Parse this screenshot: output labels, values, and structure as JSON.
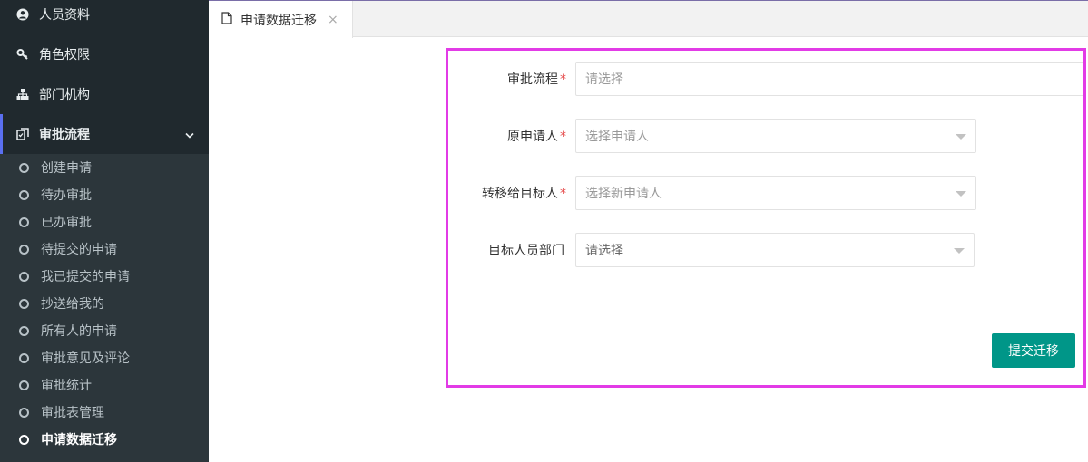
{
  "sidebar": {
    "items": [
      {
        "label": "人员资料",
        "icon": "user-circle-icon"
      },
      {
        "label": "角色权限",
        "icon": "key-icon"
      },
      {
        "label": "部门机构",
        "icon": "org-chart-icon"
      },
      {
        "label": "审批流程",
        "icon": "approval-icon",
        "expanded": true
      }
    ],
    "sub_items": [
      {
        "label": "创建申请"
      },
      {
        "label": "待办审批"
      },
      {
        "label": "已办审批"
      },
      {
        "label": "待提交的申请"
      },
      {
        "label": "我已提交的申请"
      },
      {
        "label": "抄送给我的"
      },
      {
        "label": "所有人的申请"
      },
      {
        "label": "审批意见及评论"
      },
      {
        "label": "审批统计"
      },
      {
        "label": "审批表管理"
      },
      {
        "label": "申请数据迁移",
        "current": true
      }
    ]
  },
  "tabs": [
    {
      "label": "申请数据迁移",
      "close": "×"
    }
  ],
  "form": {
    "fields": [
      {
        "label": "审批流程",
        "required_mark": "*",
        "placeholder": "请选择"
      },
      {
        "label": "原申请人",
        "required_mark": "*",
        "placeholder": "选择申请人"
      },
      {
        "label": "转移给目标人",
        "required_mark": "*",
        "placeholder": "选择新申请人"
      },
      {
        "label": "目标人员部门",
        "required_mark": "",
        "placeholder": "请选择"
      }
    ],
    "submit_label": "提交迁移"
  },
  "colors": {
    "sidebar_bg": "#20292e",
    "submenu_bg": "#2c363b",
    "active_accent": "#5a6ff0",
    "primary_button": "#009688",
    "highlight_border": "#e23be6",
    "required": "#e54a4a"
  }
}
